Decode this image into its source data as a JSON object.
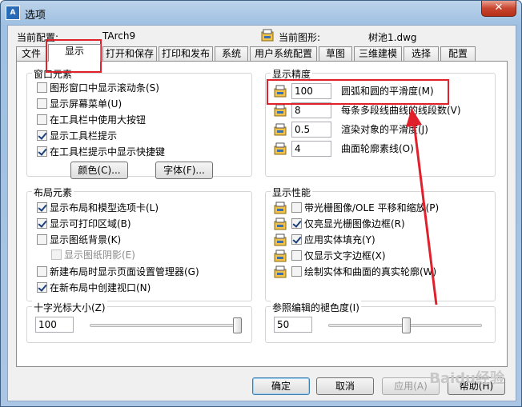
{
  "window": {
    "title": "选项",
    "close_glyph": "✕",
    "app_icon": "autocad-icon"
  },
  "header": {
    "profile_label": "当前配置:",
    "profile_value": "TArch9",
    "drawing_label": "当前图形:",
    "drawing_value": "树池1.dwg"
  },
  "tabs": [
    "文件",
    "显示",
    "打开和保存",
    "打印和发布",
    "系统",
    "用户系统配置",
    "草图",
    "三维建模",
    "选择",
    "配置"
  ],
  "window_elements": {
    "title": "窗口元素",
    "items": [
      {
        "label": "图形窗口中显示滚动条(S)",
        "checked": false
      },
      {
        "label": "显示屏幕菜单(U)",
        "checked": false
      },
      {
        "label": "在工具栏中使用大按钮",
        "checked": false
      },
      {
        "label": "显示工具栏提示",
        "checked": true
      },
      {
        "label": "在工具栏提示中显示快捷键",
        "checked": true
      }
    ],
    "color_button": "颜色(C)...",
    "font_button": "字体(F)..."
  },
  "layout_elements": {
    "title": "布局元素",
    "items": [
      {
        "label": "显示布局和模型选项卡(L)",
        "checked": true
      },
      {
        "label": "显示可打印区域(B)",
        "checked": true
      },
      {
        "label": "显示图纸背景(K)",
        "checked": false
      },
      {
        "label": "显示图纸阴影(E)",
        "checked": false,
        "disabled": true
      },
      {
        "label": "新建布局时显示页面设置管理器(G)",
        "checked": false
      },
      {
        "label": "在新布局中创建视口(N)",
        "checked": true
      }
    ]
  },
  "crosshair": {
    "title": "十字光标大小(Z)",
    "value": "100",
    "slider_fraction": 1.0
  },
  "display_resolution": {
    "title": "显示精度",
    "items": [
      {
        "value": "100",
        "label": "圆弧和圆的平滑度(M)"
      },
      {
        "value": "8",
        "label": "每条多段线曲线的线段数(V)"
      },
      {
        "value": "0.5",
        "label": "渲染对象的平滑度(J)"
      },
      {
        "value": "4",
        "label": "曲面轮廓素线(O)"
      }
    ]
  },
  "display_performance": {
    "title": "显示性能",
    "items": [
      {
        "label": "带光栅图像/OLE 平移和缩放(P)",
        "checked": false
      },
      {
        "label": "仅亮显光栅图像边框(R)",
        "checked": true
      },
      {
        "label": "应用实体填充(Y)",
        "checked": true
      },
      {
        "label": "仅显示文字边框(X)",
        "checked": false
      },
      {
        "label": "绘制实体和曲面的真实轮廓(W)",
        "checked": false
      }
    ]
  },
  "xref_fade": {
    "title": "参照编辑的褪色度(I)",
    "value": "50",
    "slider_fraction": 0.5
  },
  "footer": {
    "ok": "确定",
    "cancel": "取消",
    "apply": "应用(A)",
    "help": "帮助(H)"
  },
  "watermark": "Baidu经验",
  "colors": {
    "annotation": "#e0212b",
    "titlebar": "#9fc0e2"
  }
}
